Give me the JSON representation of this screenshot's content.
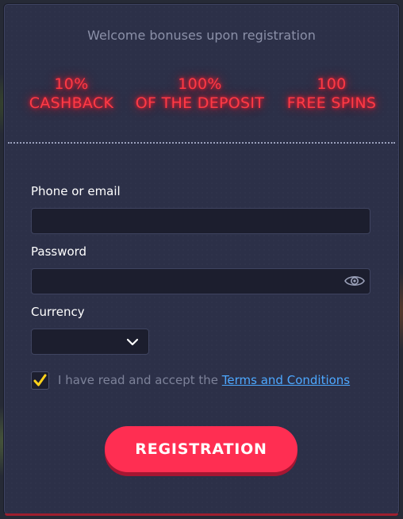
{
  "welcome": "Welcome bonuses upon registration",
  "bonuses": [
    {
      "value": "10%",
      "label": "CASHBACK"
    },
    {
      "value": "100%",
      "label": "OF THE DEPOSIT"
    },
    {
      "value": "100",
      "label": "FREE SPINS"
    }
  ],
  "form": {
    "phone_label": "Phone or email",
    "phone_value": "",
    "password_label": "Password",
    "password_value": "",
    "currency_label": "Currency",
    "currency_value": ""
  },
  "terms": {
    "checked": true,
    "text": "I have read and accept the",
    "link": "Terms and Conditions"
  },
  "submit_label": "REGISTRATION",
  "icons": {
    "password_toggle": "eye-icon",
    "currency_dropdown": "chevron-down-icon",
    "checkbox_mark": "checkmark-icon"
  },
  "colors": {
    "neon": "#ff3a46",
    "button": "#ff2e52",
    "link": "#4da8ff",
    "check": "#ffd21a"
  }
}
